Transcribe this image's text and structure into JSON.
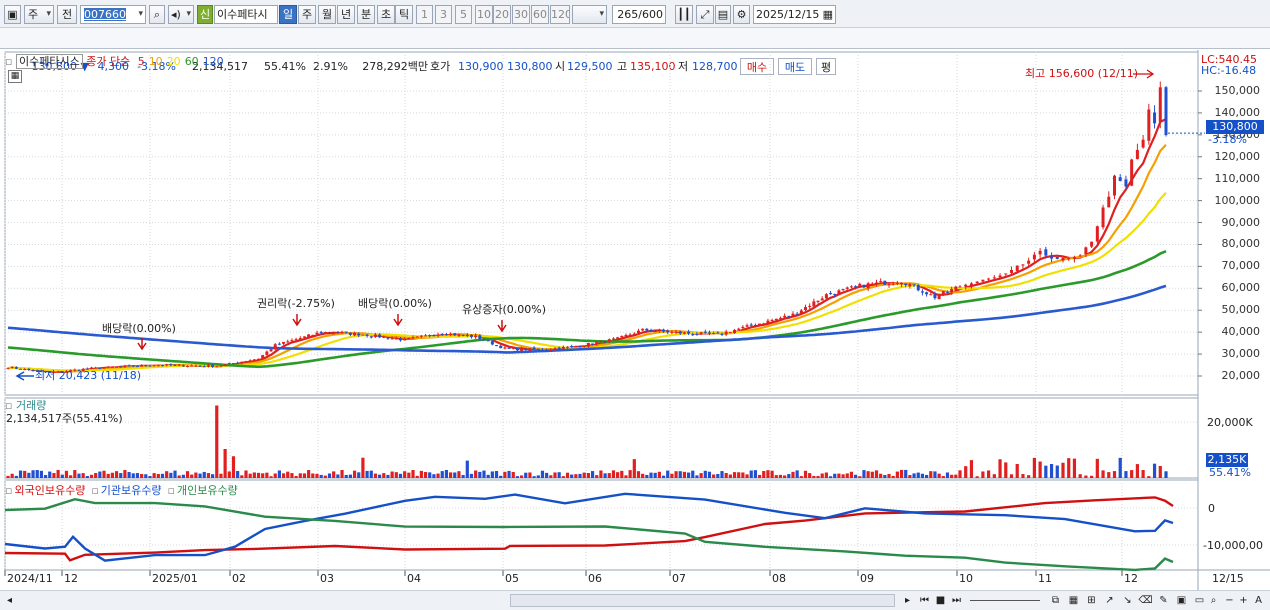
{
  "toolbar": {
    "period_label": "주",
    "prev_label": "전",
    "stock_code": "007660",
    "badge_label": "신",
    "stock_name": "이수페타시",
    "timeframes": [
      "일",
      "주",
      "월",
      "년",
      "분",
      "초",
      "틱"
    ],
    "active_timeframe": "일",
    "intervals": [
      "1",
      "3",
      "5",
      "10",
      "20",
      "30",
      "60",
      "120"
    ],
    "count_value": "265",
    "count_total": "/600",
    "date_value": "2025/12/15"
  },
  "quote": {
    "price": "130,800 ▼",
    "change": "4,300",
    "change_pct": "-3.18%",
    "volume": "2,134,517",
    "volume_ratio": "55.41%",
    "turnover": "2.91%",
    "amount": "278,292백만",
    "bid_label": "호가",
    "bid": "130,900",
    "ask": "130,800",
    "open_label": "시",
    "open": "129,500",
    "high_label": "고",
    "high": "135,100",
    "low_label": "저",
    "low": "128,700",
    "buy_label": "매수",
    "sell_label": "매도",
    "flat_label": "평"
  },
  "price_panel": {
    "name": "이수페타시스",
    "indicator": "종가 단순",
    "ma_periods": [
      "5",
      "10",
      "20",
      "60",
      "120"
    ],
    "ma_colors": [
      "#e02020",
      "#f5a000",
      "#f0e000",
      "#2a9a2a",
      "#2a5ad0"
    ],
    "lc_label": "LC:540.45",
    "hc_label": "HC:-16.48",
    "high_note": "최고 156,600 (12/11)",
    "low_note": "최저 20,423 (11/18)",
    "current_price": "130,800",
    "current_pct": "-3.18%",
    "y_ticks": [
      "150,000",
      "140,000",
      "130,000",
      "120,000",
      "110,000",
      "100,000",
      "90,000",
      "80,000",
      "70,000",
      "60,000",
      "50,000",
      "40,000",
      "30,000",
      "20,000"
    ],
    "events": [
      {
        "label": "배당락(0.00%)"
      },
      {
        "label": "권리락(-2.75%)"
      },
      {
        "label": "배당락(0.00%)"
      },
      {
        "label": "유상증자(0.00%)"
      }
    ]
  },
  "volume_panel": {
    "title": "거래량",
    "value": "2,134,517주(55.41%)",
    "y_tick": "20,000K",
    "current": "2,135K",
    "current_pct": "55.41%"
  },
  "holding_panel": {
    "legend": [
      "외국인보유수량",
      "기관보유수량",
      "개인보유수량"
    ],
    "legend_colors": [
      "#d01010",
      "#1450c8",
      "#2a8a4a"
    ],
    "y_ticks": [
      "0",
      "-10,000,00"
    ]
  },
  "x_axis": {
    "labels": [
      "2024/11",
      "12",
      "2025/01",
      "02",
      "03",
      "04",
      "05",
      "06",
      "07",
      "08",
      "09",
      "10",
      "11",
      "12"
    ],
    "right_label": "12/15"
  },
  "colors": {
    "up": "#e02020",
    "down": "#2050d0",
    "grid": "#c8cfd9"
  }
}
